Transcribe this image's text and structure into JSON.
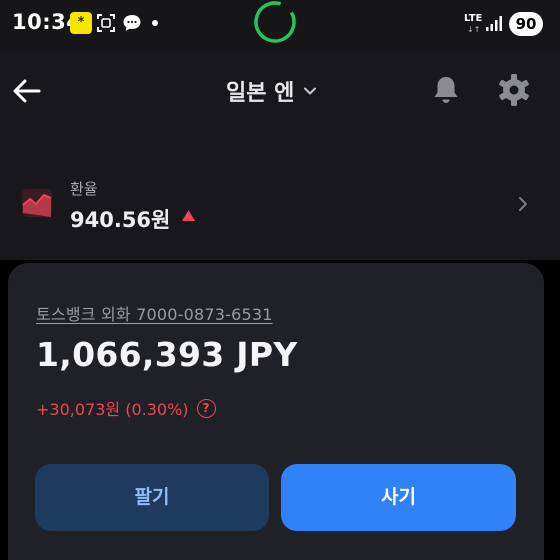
{
  "status_bar": {
    "time": "10:34",
    "kakao_icon_text": "*",
    "network": "LTE",
    "network_arrows": "↓↑",
    "battery": "90",
    "icons": [
      "kakao-icon",
      "scan-icon",
      "chat-icon",
      "dot-icon",
      "progress-ring-icon",
      "signal-icon",
      "battery-icon"
    ],
    "ring_color": "#22c55e"
  },
  "header": {
    "title": "일본 엔",
    "icons": [
      "back-arrow-icon",
      "chevron-down-icon",
      "bell-icon",
      "gear-icon"
    ]
  },
  "exchange_rate": {
    "label": "환율",
    "value": "940.56원",
    "trend": "up",
    "icons": [
      "chart-up-icon",
      "triangle-up-icon",
      "chevron-right-icon"
    ]
  },
  "account": {
    "name": "토스뱅크 외화 7000-0873-6531",
    "balance": "1,066,393 JPY",
    "change": "+30,073원 (0.30%)",
    "help_icon_text": "?"
  },
  "actions": {
    "sell_label": "팔기",
    "buy_label": "사기"
  },
  "colors": {
    "background": "#000000",
    "header_bg": "#17171c",
    "card_bg": "#202027",
    "accent_blue": "#3182f6",
    "sell_bg": "#1e3a5f",
    "up_red": "#f04452"
  }
}
